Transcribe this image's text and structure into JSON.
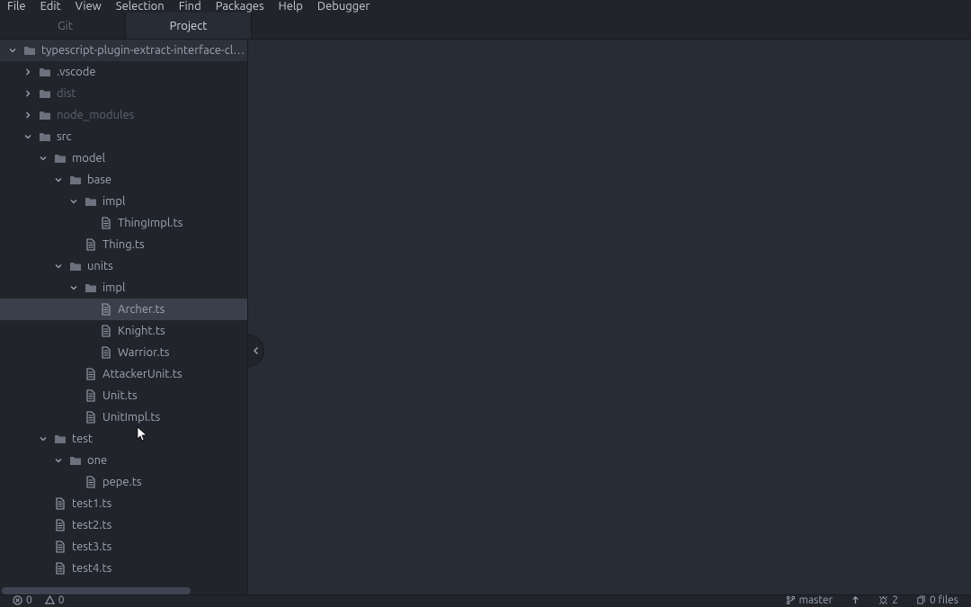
{
  "menu": [
    "File",
    "Edit",
    "View",
    "Selection",
    "Find",
    "Packages",
    "Help",
    "Debugger"
  ],
  "tabs": {
    "git": "Git",
    "project": "Project"
  },
  "tree": [
    {
      "depth": 0,
      "type": "folder",
      "expanded": true,
      "label": "typescript-plugin-extract-interface-client",
      "root": true
    },
    {
      "depth": 1,
      "type": "folder",
      "expanded": false,
      "label": ".vscode"
    },
    {
      "depth": 1,
      "type": "folder",
      "expanded": false,
      "label": "dist",
      "dimmed": true
    },
    {
      "depth": 1,
      "type": "folder",
      "expanded": false,
      "label": "node_modules",
      "dimmed": true
    },
    {
      "depth": 1,
      "type": "folder",
      "expanded": true,
      "label": "src"
    },
    {
      "depth": 2,
      "type": "folder",
      "expanded": true,
      "label": "model"
    },
    {
      "depth": 3,
      "type": "folder",
      "expanded": true,
      "label": "base"
    },
    {
      "depth": 4,
      "type": "folder",
      "expanded": true,
      "label": "impl"
    },
    {
      "depth": 5,
      "type": "file",
      "label": "ThingImpl.ts"
    },
    {
      "depth": 4,
      "type": "file",
      "label": "Thing.ts"
    },
    {
      "depth": 3,
      "type": "folder",
      "expanded": true,
      "label": "units"
    },
    {
      "depth": 4,
      "type": "folder",
      "expanded": true,
      "label": "impl"
    },
    {
      "depth": 5,
      "type": "file",
      "label": "Archer.ts",
      "selected": true
    },
    {
      "depth": 5,
      "type": "file",
      "label": "Knight.ts"
    },
    {
      "depth": 5,
      "type": "file",
      "label": "Warrior.ts"
    },
    {
      "depth": 4,
      "type": "file",
      "label": "AttackerUnit.ts"
    },
    {
      "depth": 4,
      "type": "file",
      "label": "Unit.ts"
    },
    {
      "depth": 4,
      "type": "file",
      "label": "UnitImpl.ts"
    },
    {
      "depth": 2,
      "type": "folder",
      "expanded": true,
      "label": "test"
    },
    {
      "depth": 3,
      "type": "folder",
      "expanded": true,
      "label": "one"
    },
    {
      "depth": 4,
      "type": "file",
      "label": "pepe.ts"
    },
    {
      "depth": 2,
      "type": "file",
      "label": "test1.ts"
    },
    {
      "depth": 2,
      "type": "file",
      "label": "test2.ts"
    },
    {
      "depth": 2,
      "type": "file",
      "label": "test3.ts"
    },
    {
      "depth": 2,
      "type": "file",
      "label": "test4.ts"
    }
  ],
  "status": {
    "errors": "0",
    "warnings": "0",
    "branch": "master",
    "linter": "2",
    "files": "0 files"
  }
}
